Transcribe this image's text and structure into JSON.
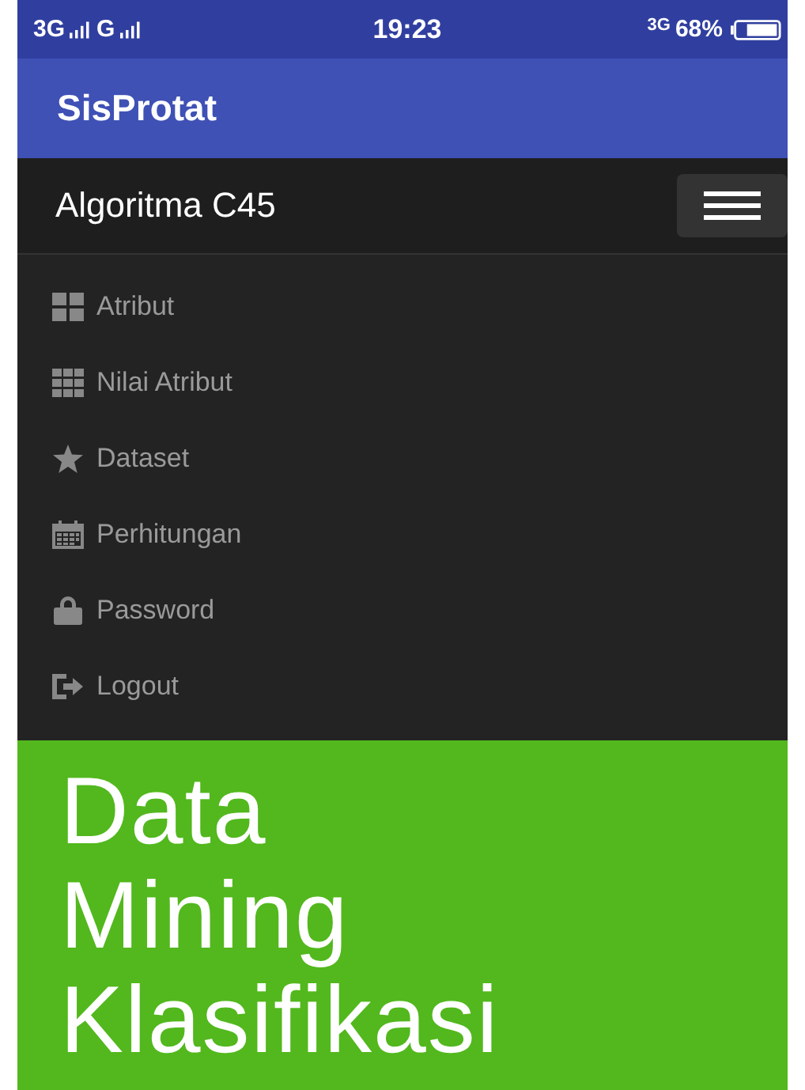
{
  "status_bar": {
    "network_1": "3G",
    "network_2": "G",
    "time": "19:23",
    "data": "3G",
    "battery": "68%"
  },
  "app_bar": {
    "title": "SisProtat"
  },
  "navbar": {
    "brand": "Algoritma C45"
  },
  "menu": [
    {
      "label": "Atribut"
    },
    {
      "label": "Nilai Atribut"
    },
    {
      "label": "Dataset"
    },
    {
      "label": "Perhitungan"
    },
    {
      "label": "Password"
    },
    {
      "label": "Logout"
    }
  ],
  "hero": {
    "heading": "Data Mining Klasifikasi"
  }
}
